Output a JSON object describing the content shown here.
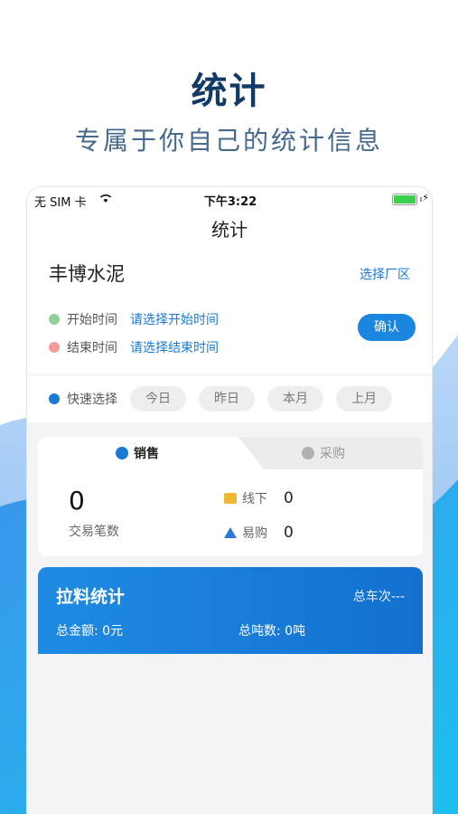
{
  "hero": {
    "title": "统计",
    "subtitle": "专属于你自己的统计信息"
  },
  "status_bar": {
    "carrier": "无 SIM 卡",
    "time": "下午3:22",
    "battery_level": 1.0
  },
  "nav": {
    "title": "统计"
  },
  "company": {
    "name": "丰博水泥",
    "select_factory_label": "选择厂区"
  },
  "date_filter": {
    "start_label": "开始时间",
    "start_placeholder": "请选择开始时间",
    "end_label": "结束时间",
    "end_placeholder": "请选择结束时间",
    "confirm_label": "确认"
  },
  "quick_select": {
    "label": "快速选择",
    "options": [
      "今日",
      "昨日",
      "本月",
      "上月"
    ]
  },
  "tabs": {
    "sales": "销售",
    "purchase": "采购"
  },
  "stats": {
    "transactions_value": "0",
    "transactions_label": "交易笔数",
    "offline_label": "线下",
    "offline_value": "0",
    "easy_label": "易购",
    "easy_value": "0"
  },
  "pull_stats": {
    "title": "拉料统计",
    "total_trips": "总车次---",
    "total_amount": "总金额: 0元",
    "total_tons": "总吨数: 0吨"
  },
  "colors": {
    "accent": "#1a7ad4",
    "hero_title": "#123a66",
    "wave_light": "#a9cdf5",
    "wave_dark": "#1a86df"
  }
}
